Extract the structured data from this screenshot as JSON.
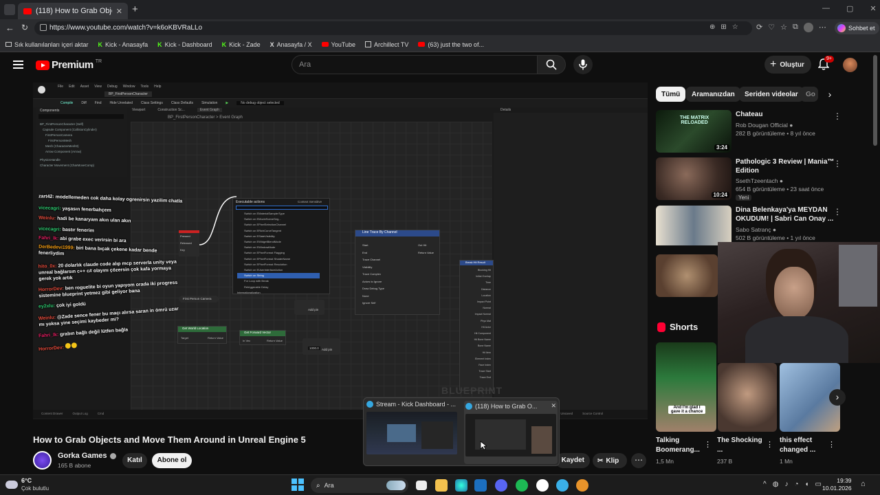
{
  "browser": {
    "tabs": [
      {
        "label": "(118) How to Grab Objects and M"
      }
    ],
    "url": "https://www.youtube.com/watch?v=k6oKBVRaLLo",
    "copilot_label": "Sohbet et",
    "bookmarks": [
      {
        "label": "Sık kullanılanları içeri aktar",
        "icon": "import-icon"
      },
      {
        "label": "Kick - Anasayfa",
        "icon": "kick-icon"
      },
      {
        "label": "Kick - Dashboard",
        "icon": "kick-icon"
      },
      {
        "label": "Kick - Zade",
        "icon": "kick-icon"
      },
      {
        "label": "Anasayfa / X",
        "icon": "x-icon"
      },
      {
        "label": "YouTube",
        "icon": "youtube-icon"
      },
      {
        "label": "Archillect TV",
        "icon": "archillect-icon"
      },
      {
        "label": "(63) just the two of...",
        "icon": "youtube-icon"
      }
    ]
  },
  "youtube": {
    "logo": "Premium",
    "logo_region": "TR",
    "search_placeholder": "Ara",
    "create_label": "Oluştur",
    "notification_badge": "9+"
  },
  "video": {
    "title": "How to Grab Objects and Move Them Around in Unreal Engine 5",
    "channel": "Gorka Games",
    "subscribers": "165 B abone",
    "join_label": "Katıl",
    "subscribe_label": "Abone ol",
    "save_label": "Kaydet",
    "clip_label": "Klip",
    "editor": {
      "tab": "BP_FirstPersonCharacter",
      "breadcrumb": "BP_FirstPersonCharacter > Event Graph",
      "menu_items": [
        "File",
        "Edit",
        "Asset",
        "View",
        "Debug",
        "Window",
        "Tools",
        "Help"
      ],
      "toolbar_items": [
        "Compile",
        "Diff",
        "Find",
        "Hide Unrelated",
        "Class Settings",
        "Class Defaults",
        "Simulation"
      ],
      "debug_select": "No debug object selected",
      "panels": {
        "components": "Components",
        "viewport": "Viewport",
        "construction": "Construction Sc...",
        "event_graph": "Event Graph",
        "details": "Details"
      },
      "components": [
        "BP_FirstPersonCharacter (Self)",
        "Capsule Component (CollisionCylinder)",
        "FirstPersonCamera",
        "FirstPersonMesh",
        "Mesh (CharacterMesh0)",
        "Arrow Component (Arrow)",
        "PhysicsHandle",
        "Character Movement (CharMoveComp)"
      ],
      "context_menu_header": "Executable actions",
      "context_menu_sensitive": "Context Sensitive",
      "context_items": [
        "Switch on EMaterialSamplerType",
        "Switch on EMovieSceneSeg...",
        "Switch on EPixelSelectionChannel",
        "Switch on ERichCurveTangent",
        "Switch on ESlateVisibility",
        "Switch on EWidgetBlendMode",
        "Switch on EWindowMode",
        "Switch on EPixelFormat Flagging",
        "Switch on EPixelFormat ShaderName",
        "Switch on EPixelFormat Resolution",
        "Switch on EUserInterfaceAction",
        "Switch on String",
        "For Loop with Break",
        "Retriggerable Delay",
        "Internationalization"
      ],
      "nodes": {
        "line_trace": "Line Trace By Channel",
        "get_world_location": "Get World Location",
        "get_forward_vector": "Get Forward Vector",
        "first_person_camera": "First Person Camera",
        "break_hit": "Break Hit Result",
        "add_pin": "Add pin",
        "multiply_value": "1000.0",
        "pin_labels": [
          "Pressed",
          "Released",
          "Key",
          "Start",
          "End",
          "Trace Channel",
          "Visibility",
          "Trace Complex",
          "Actors to Ignore",
          "Draw Debug Type",
          "None",
          "Ignore Self",
          "Out Hit",
          "Return Value",
          "Target",
          "Return Value",
          "In Vec",
          "Return Value",
          "Blocking Hit",
          "Initial Overlap",
          "Time",
          "Distance",
          "Location",
          "Impact Point",
          "Normal",
          "Impact Normal",
          "Phys Mat",
          "Hit Actor",
          "Hit Component",
          "Hit Bone Name",
          "Bone Name",
          "Hit Item",
          "Element Index",
          "Face Index",
          "Trace Start",
          "Trace End"
        ],
        "watermark": "BLUEPRINT"
      },
      "status": [
        "Content Drawer",
        "Output Log",
        "Cmd",
        "Unsaved",
        "Source Control"
      ]
    },
    "chat": [
      {
        "user": "zart42:",
        "text": "modellemeden cok daha kolay ogrenirsin yazilim chatla",
        "color": "#ffffff"
      },
      {
        "user": "vicecagri:",
        "text": "yaşasın fenerbahçem",
        "color": "#2ecc71"
      },
      {
        "user": "Weinlu:",
        "text": "hadi be kanaryam akın ulan akın",
        "color": "#e74c3c"
      },
      {
        "user": "vicecagri:",
        "text": "bastır fenerim",
        "color": "#2ecc71"
      },
      {
        "user": "Fahri_lk:",
        "text": "abi grabe exec verirsin bi ara",
        "color": "#e91e63"
      },
      {
        "user": "DerBedevi1999:",
        "text": "biri bana bıçak çekene kadar bende fenerliydim",
        "color": "#f39c12"
      },
      {
        "user": "hito_0x:",
        "text": "20 dolarlık claude code alıp mcp serverla unity veya unreal bağlarsın c++ c# olayını çözersin çok kafa yormaya gerek yok artık",
        "color": "#e74c3c"
      },
      {
        "user": "HorrorDev:",
        "text": "ben roguelite bi oyun yapıyom orada iki progress sistemine blueprint yetmez gibi geliyor bana",
        "color": "#e74c3c"
      },
      {
        "user": "ey2xlu:",
        "text": "çok iyi goldü",
        "color": "#2ecc71"
      },
      {
        "user": "Weinlu:",
        "text": "@Zade sence fener bu maçı alırsa saran in ömrü uzar mı yoksa yine seçimi kaybeder mi?",
        "color": "#e74c3c"
      },
      {
        "user": "Fahri_lk:",
        "text": "grabın bağlı değil lütfen bağla",
        "color": "#e91e63"
      },
      {
        "user": "HorrorDev:",
        "text": "",
        "color": "#e74c3c"
      }
    ]
  },
  "sidebar": {
    "chips": [
      "Tümü",
      "Aramanızdan",
      "Seriden videolar",
      "Go"
    ],
    "recommendations": [
      {
        "title": "Chateau",
        "channel": "Rob Dougan Official",
        "meta": "282 B görüntüleme • 8 yıl önce",
        "duration": "3:24",
        "thumb_text": "THE MATRIX RELOADED"
      },
      {
        "title": "Pathologic 3 Review | Mania™ Edition",
        "channel": "SsethTzeentach",
        "meta": "654 B görüntüleme • 23 saat önce",
        "duration": "10:24",
        "badge": "Yeni"
      },
      {
        "title": "Dina Belenkaya'ya MEYDAN OKUDUM! | Sabri Can Onay ...",
        "channel": "Sabo Satranç",
        "meta": "502 B görüntüleme • 1 yıl önce"
      }
    ],
    "shorts_title": "Shorts",
    "shorts": [
      {
        "title": "Talking Boomerang...",
        "views": "1,5 Mn",
        "thumb_text": "And I'm glad I gave it a chance"
      },
      {
        "title": "The Shocking ...",
        "views": "237 B"
      },
      {
        "title": "this effect changed ...",
        "views": "1 Mn"
      }
    ]
  },
  "tab_previews": [
    {
      "label": "Stream - Kick Dashboard - ..."
    },
    {
      "label": "(118) How to Grab O..."
    }
  ],
  "taskbar": {
    "weather_temp": "6°C",
    "weather_desc": "Çok bulutlu",
    "search_label": "Ara",
    "time": "19:39",
    "date": "10.01.2026"
  }
}
